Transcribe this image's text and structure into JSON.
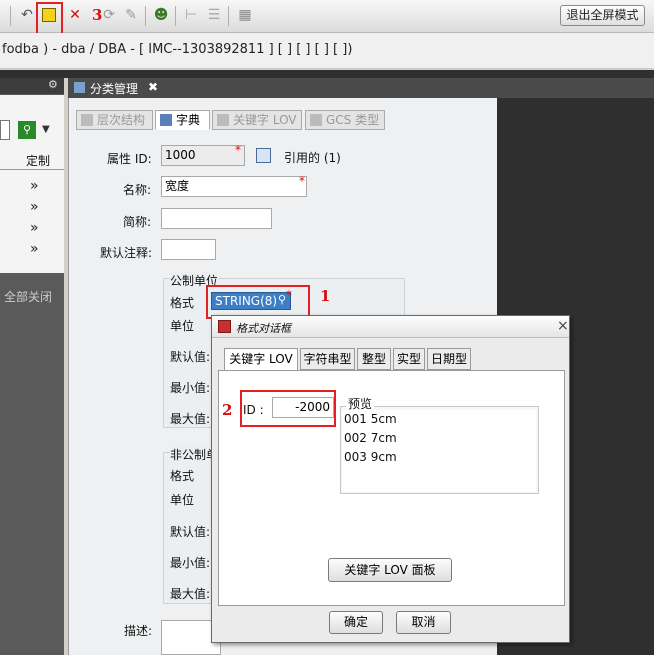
{
  "toolbar": {
    "icons": [
      "undo-icon",
      "save-icon",
      "delete-icon",
      "refresh-icon",
      "settings-icon",
      "user-icon",
      "tree-icon",
      "list-icon",
      "table-icon"
    ],
    "exit_fullscreen_label": "退出全屏模式"
  },
  "pathbar": {
    "text": "fodba ) - dba / DBA - [ IMC--1303892811 ] [ ] [ ] [ ]  [  ])"
  },
  "left_panel": {
    "header_label": "定制",
    "close_all_label": "全部关闭",
    "chevron": "»"
  },
  "main_tab": {
    "title": "分类管理",
    "close": "✖"
  },
  "subtabs": [
    {
      "label": "层次结构",
      "active": false
    },
    {
      "label": "字典",
      "active": true
    },
    {
      "label": "关键字 LOV",
      "active": false
    },
    {
      "label": "GCS 类型",
      "active": false
    }
  ],
  "form": {
    "attr_id_label": "属性 ID:",
    "attr_id_value": "1000",
    "referenced_label": "引用的 (1)",
    "name_label": "名称:",
    "name_value": "宽度",
    "short_label": "简称:",
    "short_value": "",
    "default_note_label": "默认注释:",
    "default_note_value": "",
    "metric_group_label": "公制单位",
    "format_label": "格式",
    "format_value": "STRING(8)",
    "unit_label": "单位",
    "default_value_label": "默认值:",
    "min_label": "最小值:",
    "max_label": "最大值:",
    "nonmetric_group_label": "非公制单",
    "nm_format_label": "格式",
    "nm_unit_label": "单位",
    "nm_default_label": "默认值:",
    "nm_min_label": "最小值:",
    "nm_max_label": "最大值:",
    "desc_label": "描述:",
    "required_mark": "*"
  },
  "annotations": {
    "n1": "1",
    "n2": "2",
    "n3": "3"
  },
  "dialog": {
    "title": "格式对话框",
    "close": "×",
    "tabs": [
      {
        "label": "关键字 LOV",
        "active": true
      },
      {
        "label": "字符串型",
        "active": false
      },
      {
        "label": "整型",
        "active": false
      },
      {
        "label": "实型",
        "active": false
      },
      {
        "label": "日期型",
        "active": false
      }
    ],
    "id_label": "ID :",
    "id_value": "-2000",
    "preview_label": "预览",
    "preview_items": [
      "001 5cm",
      "002 7cm",
      "003 9cm"
    ],
    "lov_panel_button": "关键字 LOV 面板",
    "ok_button": "确定",
    "cancel_button": "取消"
  },
  "colors": {
    "annotation_red": "#e52020",
    "selected_field": "#3d7fc6"
  }
}
